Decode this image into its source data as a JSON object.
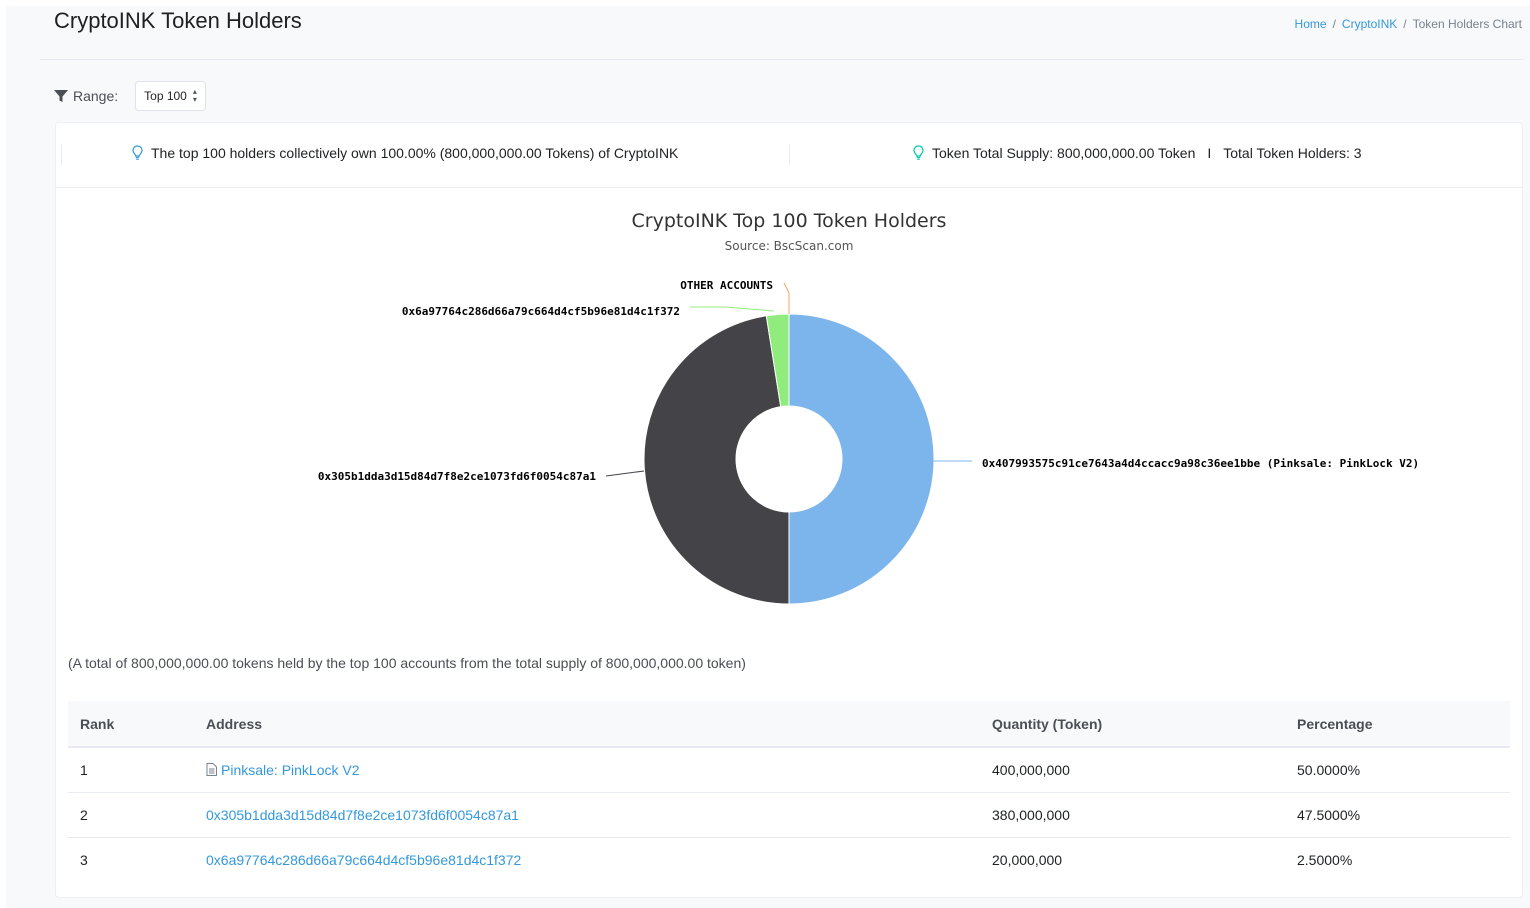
{
  "page": {
    "title": "CryptoINK Token Holders",
    "breadcrumb": [
      "Home",
      "CryptoINK",
      "Token Holders Chart"
    ]
  },
  "range": {
    "label": "Range:",
    "selected": "Top 100"
  },
  "stats": {
    "holders_note": "The top 100 holders collectively own 100.00% (800,000,000.00 Tokens) of CryptoINK",
    "total_supply": "Token Total Supply: 800,000,000.00 Token",
    "separator": "I",
    "total_holders": "Total Token Holders: 3"
  },
  "summary": "(A total of 800,000,000.00 tokens held by the top 100 accounts from the total supply of 800,000,000.00 token)",
  "table": {
    "headers": [
      "Rank",
      "Address",
      "Quantity (Token)",
      "Percentage"
    ],
    "rows": [
      {
        "rank": "1",
        "address": "Pinksale: PinkLock V2",
        "quantity": "400,000,000",
        "percentage": "50.0000%",
        "is_contract": true
      },
      {
        "rank": "2",
        "address": "0x305b1dda3d15d84d7f8e2ce1073fd6f0054c87a1",
        "quantity": "380,000,000",
        "percentage": "47.5000%",
        "is_contract": false
      },
      {
        "rank": "3",
        "address": "0x6a97764c286d66a79c664d4cf5b96e81d4c1f372",
        "quantity": "20,000,000",
        "percentage": "2.5000%",
        "is_contract": false
      }
    ]
  },
  "chart_data": {
    "type": "pie",
    "title": "CryptoINK Top 100 Token Holders",
    "subtitle": "Source: BscScan.com",
    "donut": true,
    "slices": [
      {
        "label": "0x407993575c91ce7643a4d4ccacc9a98c36ee1bbe (Pinksale: PinkLock V2)",
        "value": 50.0,
        "color": "#7cb5ec"
      },
      {
        "label": "0x305b1dda3d15d84d7f8e2ce1073fd6f0054c87a1",
        "value": 47.5,
        "color": "#434348"
      },
      {
        "label": "0x6a97764c286d66a79c664d4cf5b96e81d4c1f372",
        "value": 2.5,
        "color": "#90ed7d"
      },
      {
        "label": "OTHER ACCOUNTS",
        "value": 0.0,
        "color": "#f7a35c"
      }
    ]
  },
  "icons": [
    "filter-icon",
    "lightbulb-icon",
    "document-icon"
  ]
}
